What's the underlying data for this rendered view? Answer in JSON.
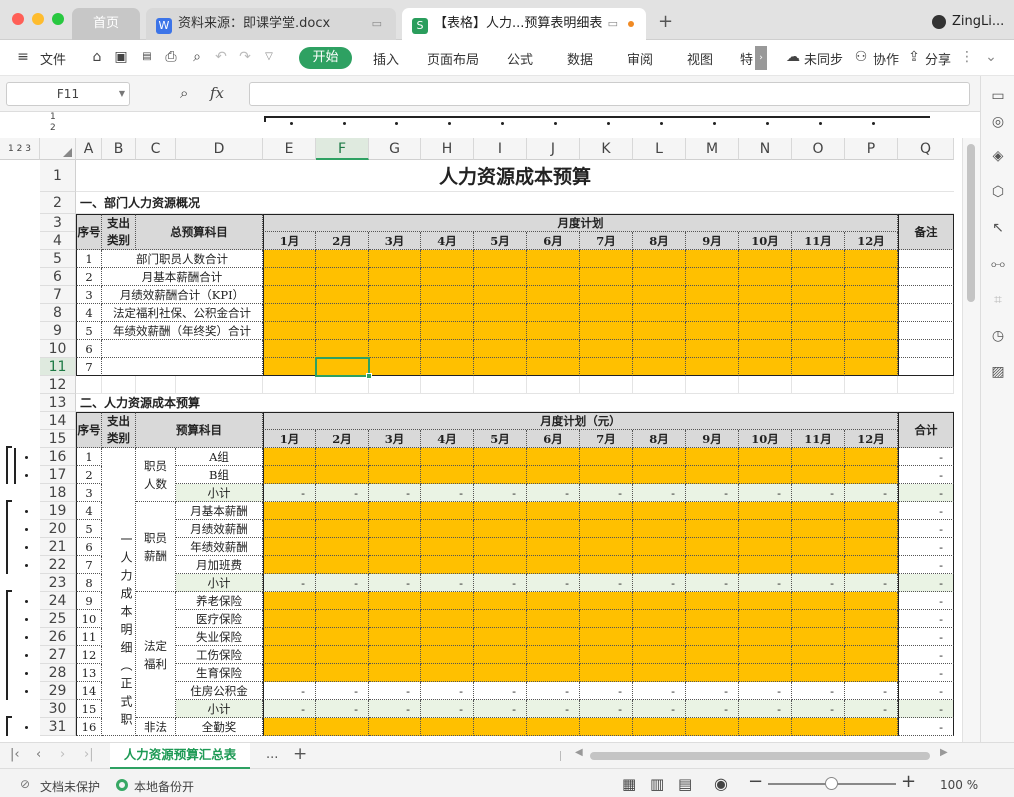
{
  "tabs": {
    "home": "首页",
    "docx": "资料来源：即课学堂.docx",
    "sheet": "【表格】人力...预算表明细表"
  },
  "user": "ZingLi...",
  "menu": {
    "file": "文件",
    "start": "开始",
    "insert": "插入",
    "layout": "页面布局",
    "formula": "公式",
    "data": "数据",
    "review": "审阅",
    "view": "视图",
    "special": "特",
    "sync": "未同步",
    "collab": "协作",
    "share": "分享"
  },
  "namebox": "F11",
  "fx": "fx",
  "outline_levels": [
    "1",
    "2",
    "3"
  ],
  "group_levels": [
    "1",
    "2"
  ],
  "columns": [
    "A",
    "B",
    "C",
    "D",
    "E",
    "F",
    "G",
    "H",
    "I",
    "J",
    "K",
    "L",
    "M",
    "N",
    "O",
    "P",
    "Q"
  ],
  "rows": [
    "1",
    "2",
    "3",
    "4",
    "5",
    "6",
    "7",
    "8",
    "9",
    "10",
    "11",
    "12",
    "13",
    "14",
    "15",
    "16",
    "17",
    "18",
    "19",
    "20",
    "21",
    "22",
    "23",
    "24",
    "25",
    "26",
    "27",
    "28",
    "29",
    "30",
    "31"
  ],
  "sheet": {
    "title": "人力资源成本预算",
    "s1": "一、部门人力资源概况",
    "s2": "二、人力资源成本预算",
    "h_seq": "序号",
    "h_cat": "支出类别",
    "h_item1": "总预算科目",
    "h_item2": "预算科目",
    "h_plan1": "月度计划",
    "h_plan2": "月度计划（元）",
    "h_note": "备注",
    "h_total": "合计",
    "months": [
      "1月",
      "2月",
      "3月",
      "4月",
      "5月",
      "6月",
      "7月",
      "8月",
      "9月",
      "10月",
      "11月",
      "12月"
    ],
    "t1": [
      {
        "n": "1",
        "name": "部门职员人数合计"
      },
      {
        "n": "2",
        "name": "月基本薪酬合计"
      },
      {
        "n": "3",
        "name": "月绩效薪酬合计（KPI）"
      },
      {
        "n": "4",
        "name": "法定福利社保、公积金合计"
      },
      {
        "n": "5",
        "name": "年绩效薪酬（年终奖）合计"
      },
      {
        "n": "6",
        "name": ""
      },
      {
        "n": "7",
        "name": ""
      }
    ],
    "t2_nums": [
      "1",
      "2",
      "3",
      "4",
      "5",
      "6",
      "7",
      "8",
      "9",
      "10",
      "11",
      "12",
      "13",
      "14",
      "15",
      "16"
    ],
    "t2_items": [
      "A组",
      "B组",
      "小计",
      "月基本薪酬",
      "月绩效薪酬",
      "年绩效薪酬",
      "月加班费",
      "小计",
      "养老保险",
      "医疗保险",
      "失业保险",
      "工伤保险",
      "生育保险",
      "住房公积金",
      "小计",
      "全勤奖"
    ],
    "groups": [
      {
        "label": "职员人数"
      },
      {
        "label": "职员薪酬"
      },
      {
        "label": "法定福利"
      },
      {
        "label": "非法"
      }
    ],
    "cat_big": "一人力成本明细（正式职",
    "dash": "-"
  },
  "sheet_tab": "人力资源预算汇总表",
  "more_tabs": "...",
  "status": {
    "protect": "文档未保护",
    "backup": "本地备份开",
    "zoom": "100 %"
  }
}
